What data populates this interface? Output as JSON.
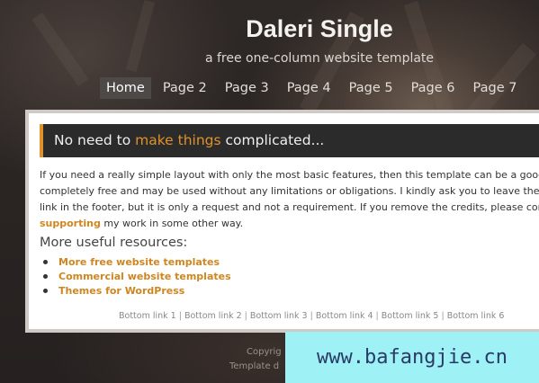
{
  "header": {
    "title": "Daleri Single",
    "tagline": "a free one-column website template"
  },
  "nav": {
    "items": [
      "Home",
      "Page 2",
      "Page 3",
      "Page 4",
      "Page 5",
      "Page 6",
      "Page 7"
    ],
    "active": "Home"
  },
  "content": {
    "headline_before": "No need to ",
    "headline_highlight": "make things",
    "headline_after": " complicated...",
    "intro_line1": "If you need a really simple layout with only the most basic features, then this template can be a good c",
    "intro_line2": "completely free and may be used without any limitations or obligations. I kindly ask you to leave the de",
    "intro_line3": "link in the footer, but it is only a request and not a requirement. If you remove the credits, please cons",
    "intro_link": "supporting",
    "intro_line4_rest": " my work in some other way.",
    "resources_heading": "More useful resources:",
    "resources": [
      "More free website templates",
      "Commercial website templates",
      "Themes for WordPress"
    ],
    "bottom_links": [
      "Bottom link 1",
      "Bottom link 2",
      "Bottom link 3",
      "Bottom link 4",
      "Bottom link 5",
      "Bottom link 6"
    ],
    "bottom_separator": "|"
  },
  "footer": {
    "line1": "Copyrig",
    "line2": "Template d"
  },
  "watermark": {
    "text": "www.bafangjie.cn"
  },
  "colors": {
    "accent": "#e0922a",
    "link": "#cf8620",
    "headline_bg": "#2b2b2b",
    "watermark_bg": "#9ef1f4"
  }
}
